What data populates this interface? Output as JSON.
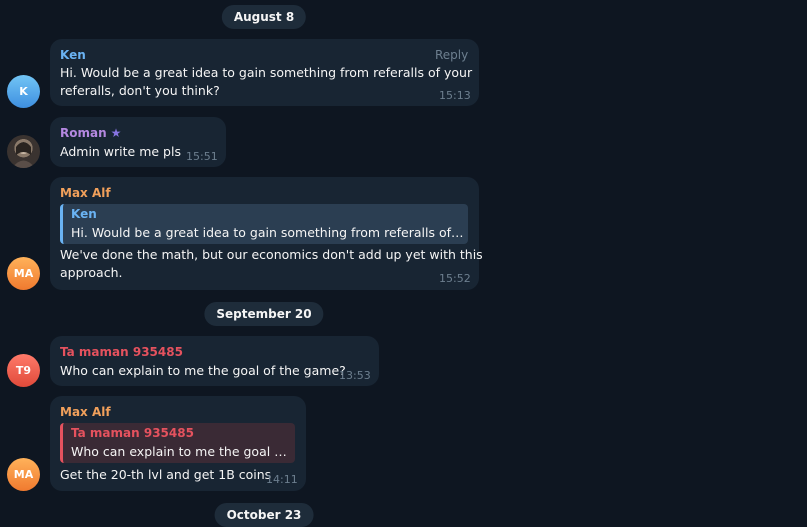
{
  "dates": [
    "August 8",
    "September 20",
    "October 23"
  ],
  "colors": {
    "background": "#0e1621",
    "bubble": "#182533",
    "ken": "#6ab3f3",
    "roman": "#b488e0",
    "max_alf": "#f1a05b",
    "ta_maman": "#e5525e"
  },
  "messages": [
    {
      "sender": "Ken",
      "avatar_initials": "K",
      "action": "Reply",
      "text_line1": "Hi. Would be a great idea to gain something from referalls of your",
      "text_line2": "referalls, don't you think?",
      "time": "15:13"
    },
    {
      "sender": "Roman",
      "badge_icon": "star-icon",
      "text": "Admin write me pls",
      "time": "15:51"
    },
    {
      "sender": "Max Alf",
      "avatar_initials": "MA",
      "quote_name": "Ken",
      "quote_text": "Hi. Would be a great idea to gain something from referalls of you...",
      "text_line1": "We've done the math, but our economics don't add up yet with this",
      "text_line2": "approach.",
      "time": "15:52"
    },
    {
      "sender": "Ta maman 935485",
      "avatar_initials": "T9",
      "text": "Who can explain to me the goal of the game?",
      "time": "13:53"
    },
    {
      "sender": "Max Alf",
      "avatar_initials": "MA",
      "quote_name": "Ta maman 935485",
      "quote_text": "Who can explain to me the goal of ...",
      "text": "Get the 20-th lvl and get 1B coins",
      "time": "14:11"
    }
  ]
}
